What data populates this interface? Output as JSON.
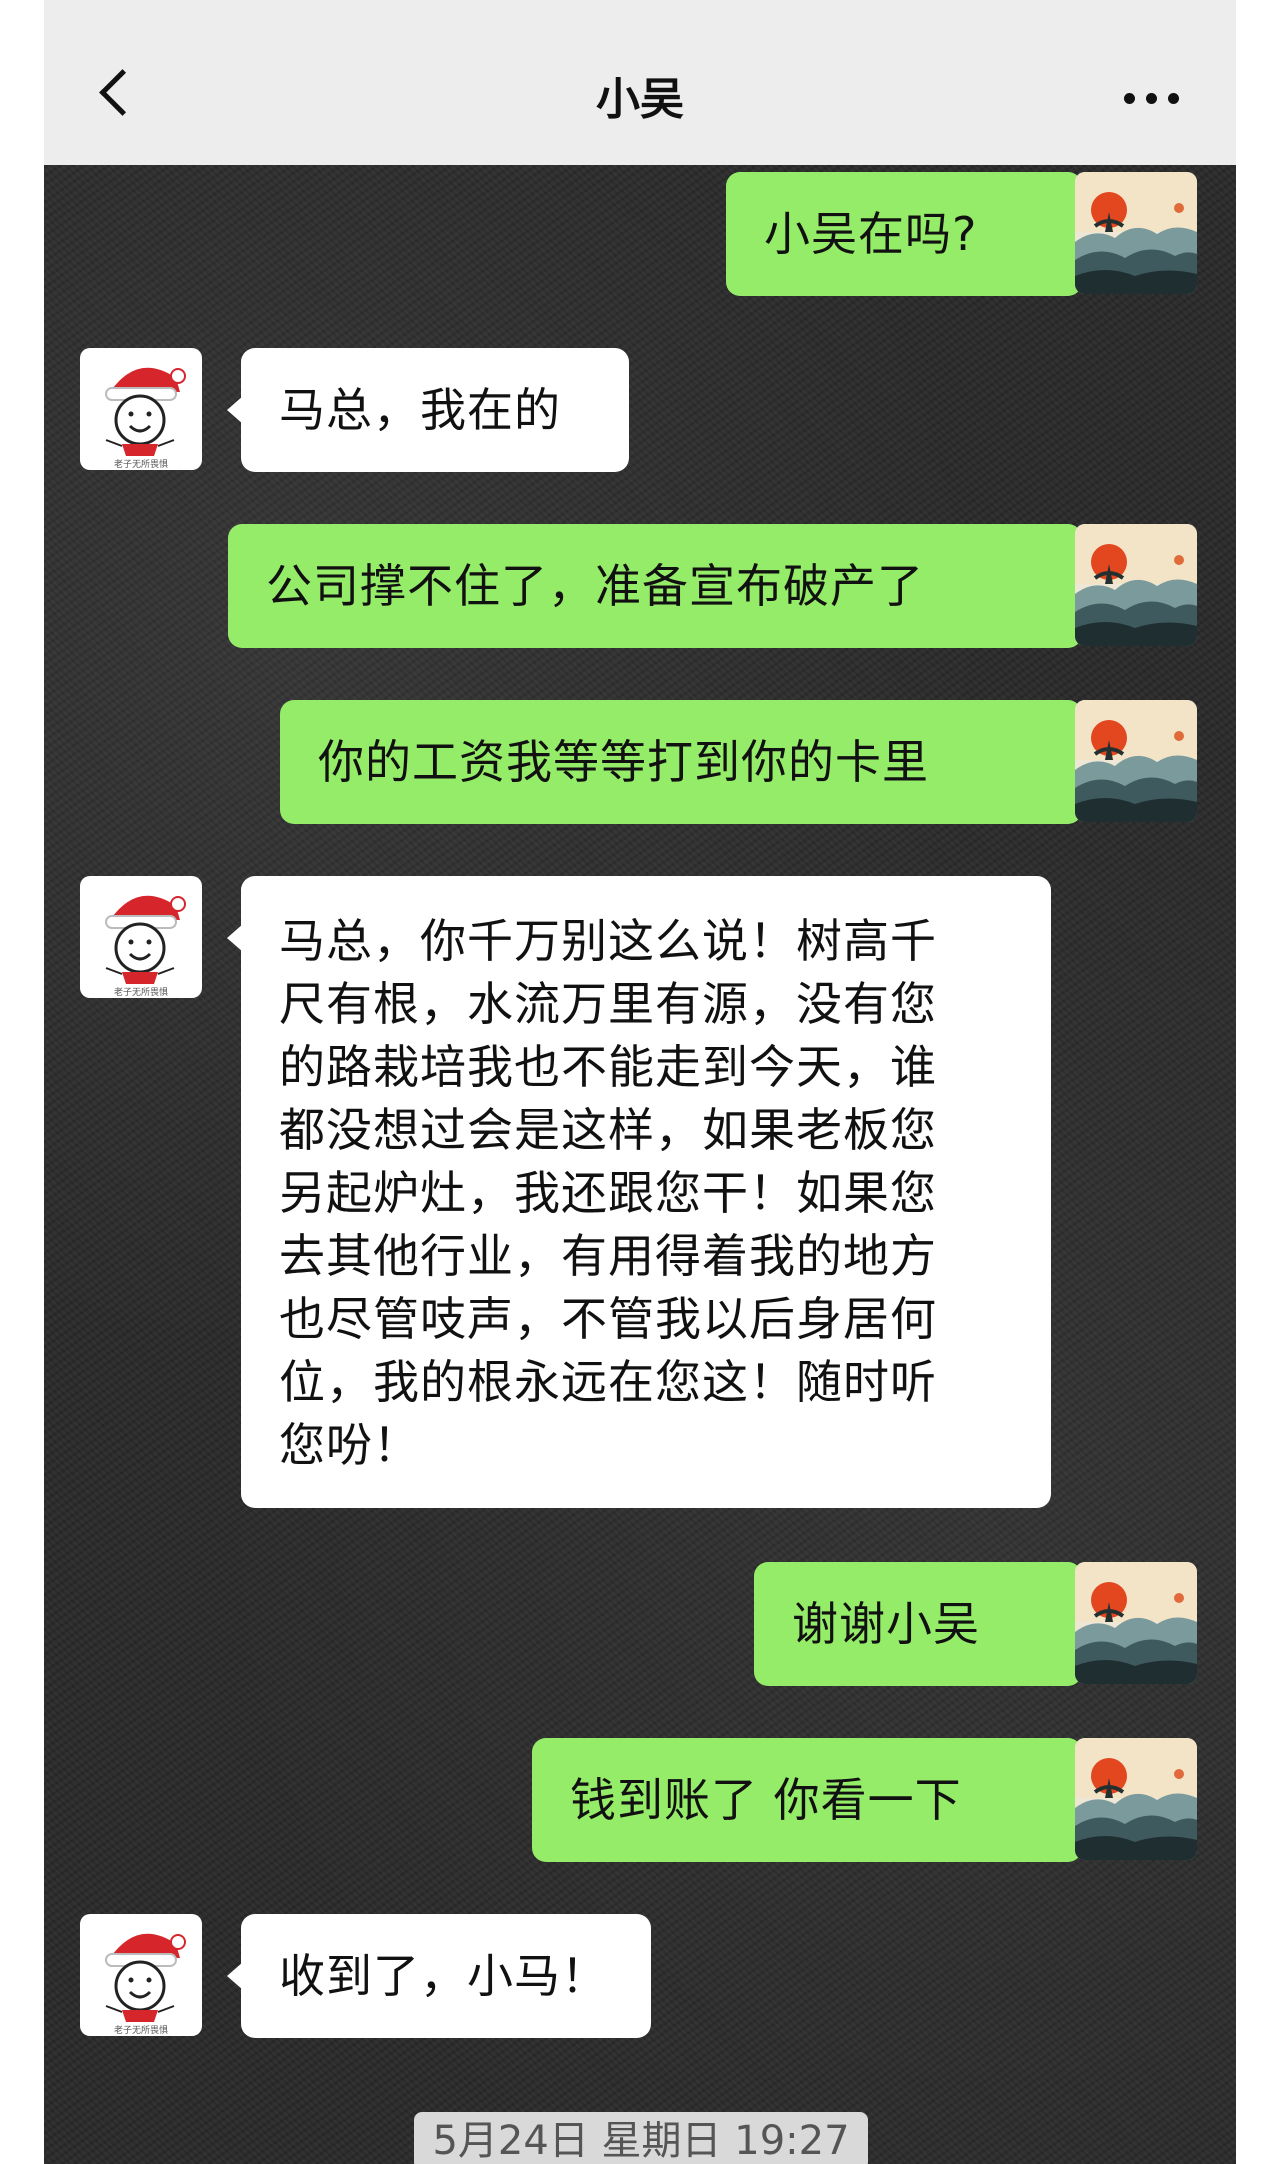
{
  "header": {
    "title": "小吴",
    "back_icon": "chevron-left-icon",
    "more_icon": "more-horizontal-icon"
  },
  "avatars": {
    "me": "sunset-landscape-avatar",
    "them": "santa-hat-smiley-avatar",
    "them_caption": "老子无所畏惧"
  },
  "colors": {
    "my_bubble": "#95ec69",
    "their_bubble": "#ffffff",
    "chat_background": "#2a2a2a"
  },
  "messages": [
    {
      "sender": "me",
      "text": "小吴在吗?"
    },
    {
      "sender": "them",
      "text": "马总，我在的"
    },
    {
      "sender": "me",
      "text": "公司撑不住了，准备宣布破产了"
    },
    {
      "sender": "me",
      "text": "你的工资我等等打到你的卡里"
    },
    {
      "sender": "them",
      "lines": [
        "马总，你千万别这么说！树高千",
        "尺有根，水流万里有源，没有您",
        "的路栽培我也不能走到今天，谁",
        "都没想过会是这样，如果老板您",
        "另起炉灶，我还跟您干！如果您",
        "去其他行业，有用得着我的地方",
        "也尽管吱声，不管我以后身居何",
        "位，我的根永远在您这！随时听",
        "您吩！"
      ]
    },
    {
      "sender": "me",
      "text": "谢谢小吴"
    },
    {
      "sender": "me",
      "text": "钱到账了 你看一下"
    },
    {
      "sender": "them",
      "text": "收到了，小马！"
    }
  ],
  "timestamp": "5月24日 星期日 19:27"
}
